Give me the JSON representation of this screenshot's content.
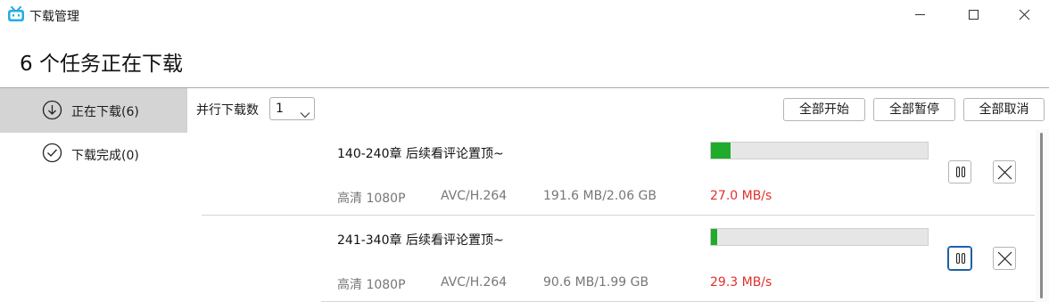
{
  "window": {
    "title": "下载管理",
    "icon": "bilibili-tv-icon",
    "controls": [
      "minimize-icon",
      "maximize-icon",
      "close-icon"
    ]
  },
  "header": {
    "title": "6 个任务正在下载"
  },
  "sidebar": {
    "items": [
      {
        "label": "正在下载(6)",
        "icon": "download-circle-icon",
        "active": true
      },
      {
        "label": "下载完成(0)",
        "icon": "check-circle-icon",
        "active": false
      }
    ]
  },
  "toolbar": {
    "concurrency_label": "并行下载数",
    "concurrency_value": "1",
    "start_all": "全部开始",
    "pause_all": "全部暂停",
    "cancel_all": "全部取消"
  },
  "tasks": [
    {
      "title": "140-240章 后续看评论置顶~",
      "quality": "高清 1080P",
      "codec": "AVC/H.264",
      "size": "191.6 MB/2.06 GB",
      "speed": "27.0 MB/s",
      "progress": 0.09
    },
    {
      "title": "241-340章 后续看评论置顶~",
      "quality": "高清 1080P",
      "codec": "AVC/H.264",
      "size": "90.6 MB/1.99 GB",
      "speed": "29.3 MB/s",
      "progress": 0.03
    }
  ],
  "colors": {
    "progress": "#1fab2b",
    "speed": "#e0302c",
    "active_sidebar": "#d4d4d4",
    "brand": "#23ade5"
  }
}
